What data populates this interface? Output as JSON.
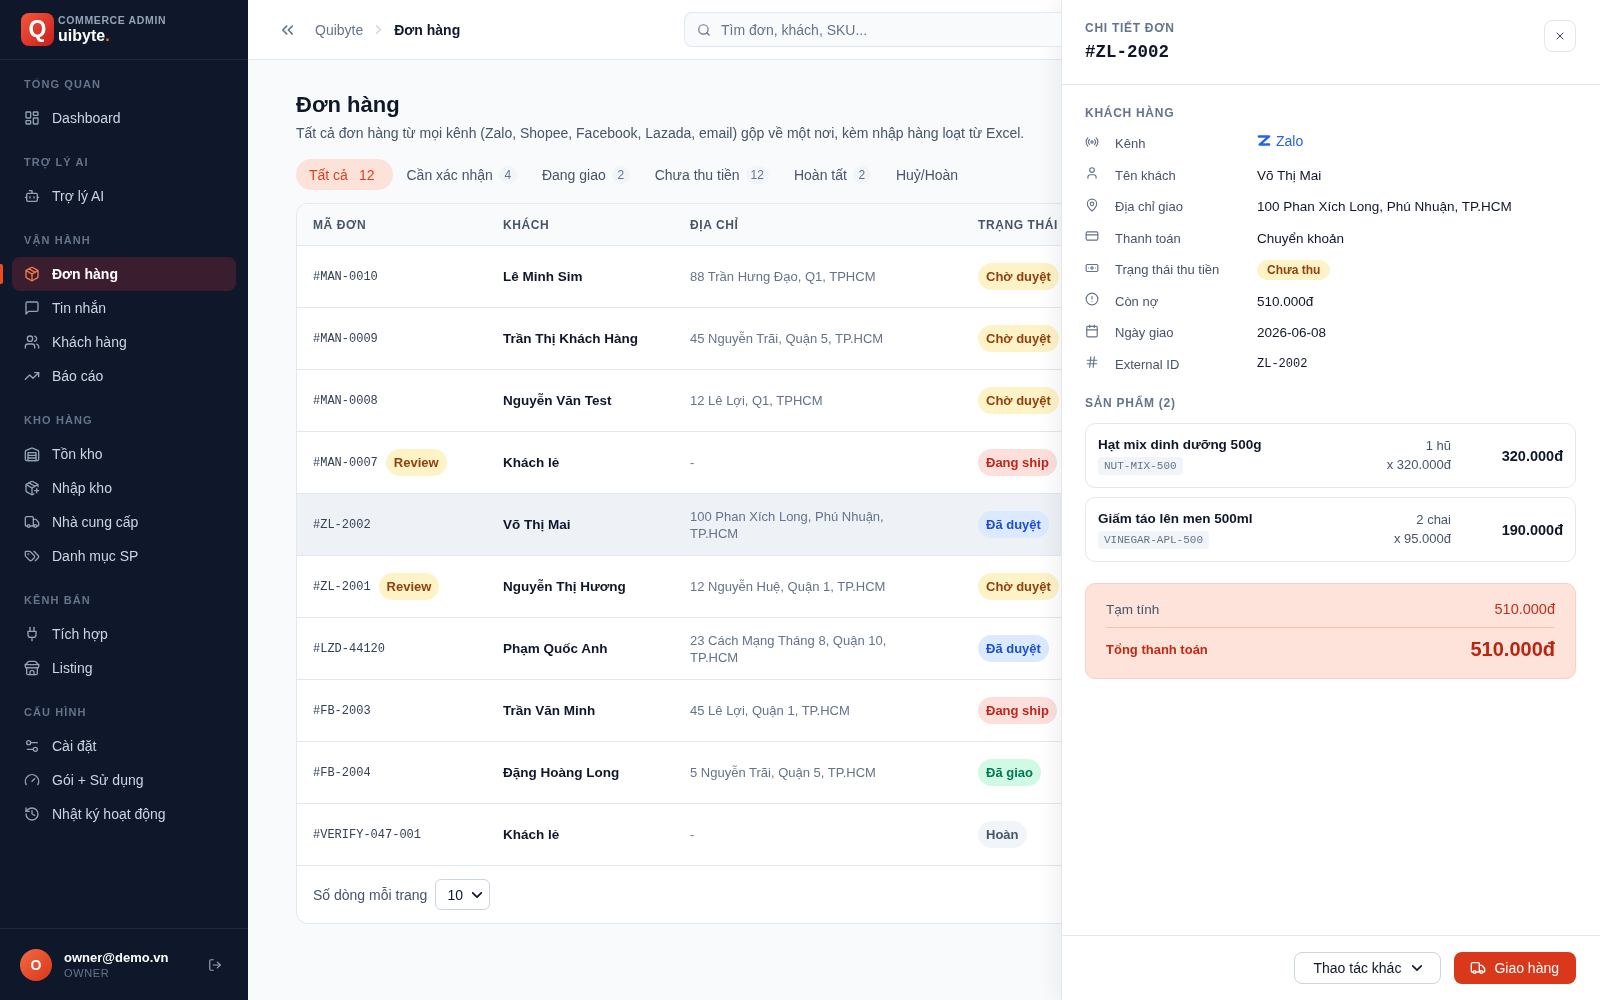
{
  "sidebar": {
    "brand": {
      "mark": "Q",
      "caption": "COMMERCE ADMIN",
      "name": "uibyte",
      "dot": "."
    },
    "sections": [
      {
        "title": "TỔNG QUAN",
        "items": [
          {
            "label": "Dashboard",
            "selected": false
          }
        ]
      },
      {
        "title": "TRỢ LÝ AI",
        "items": [
          {
            "label": "Trợ lý AI",
            "selected": false
          }
        ]
      },
      {
        "title": "VẬN HÀNH",
        "items": [
          {
            "label": "Đơn hàng",
            "selected": true
          },
          {
            "label": "Tin nhắn",
            "selected": false
          },
          {
            "label": "Khách hàng",
            "selected": false
          },
          {
            "label": "Báo cáo",
            "selected": false
          }
        ]
      },
      {
        "title": "KHO HÀNG",
        "items": [
          {
            "label": "Tồn kho",
            "selected": false
          },
          {
            "label": "Nhập kho",
            "selected": false
          },
          {
            "label": "Nhà cung cấp",
            "selected": false
          },
          {
            "label": "Danh mục SP",
            "selected": false
          }
        ]
      },
      {
        "title": "KÊNH BÁN",
        "items": [
          {
            "label": "Tích hợp",
            "selected": false
          },
          {
            "label": "Listing",
            "selected": false
          }
        ]
      },
      {
        "title": "CẤU HÌNH",
        "items": [
          {
            "label": "Cài đặt",
            "selected": false
          },
          {
            "label": "Gói + Sử dụng",
            "selected": false
          },
          {
            "label": "Nhật ký hoạt động",
            "selected": false
          }
        ]
      }
    ],
    "user": {
      "initial": "O",
      "email": "owner@demo.vn",
      "role": "OWNER"
    }
  },
  "topbar": {
    "breadcrumb": [
      {
        "label": "Quibyte"
      },
      {
        "label": "Đơn hàng"
      }
    ],
    "search": {
      "placeholder": "Tìm đơn, khách, SKU..."
    }
  },
  "page": {
    "title": "Đơn hàng",
    "subtitle": "Tất cả đơn hàng từ mọi kênh (Zalo, Shopee, Facebook, Lazada, email) gộp về một nơi, kèm nhập hàng loạt từ Excel.",
    "tabs": [
      {
        "label": "Tất cả",
        "count": "12",
        "selected": true
      },
      {
        "label": "Cần xác nhận",
        "count": "4",
        "selected": false
      },
      {
        "label": "Đang giao",
        "count": "2",
        "selected": false
      },
      {
        "label": "Chưa thu tiền",
        "count": "12",
        "selected": false
      },
      {
        "label": "Hoàn tất",
        "count": "2",
        "selected": false
      },
      {
        "label": "Huỷ/Hoàn",
        "selected": false
      }
    ],
    "table": {
      "columns": [
        "MÃ ĐƠN",
        "KHÁCH",
        "ĐỊA CHỈ",
        "TRẠNG THÁI"
      ],
      "rows": [
        {
          "id": "#MAN-0010",
          "customer": "Lê Minh Sim",
          "address": "88 Trần Hưng Đạo, Q1, TPHCM",
          "status": {
            "label": "Chờ duyệt",
            "kind": "pending"
          },
          "selected": false
        },
        {
          "id": "#MAN-0009",
          "customer": "Trần Thị Khách Hàng",
          "address": "45 Nguyễn Trãi, Quận 5, TP.HCM",
          "status": {
            "label": "Chờ duyệt",
            "kind": "pending"
          },
          "selected": false
        },
        {
          "id": "#MAN-0008",
          "customer": "Nguyễn Văn Test",
          "address": "12 Lê Lợi, Q1, TPHCM",
          "status": {
            "label": "Chờ duyệt",
            "kind": "pending"
          },
          "selected": false
        },
        {
          "id": "#MAN-0007",
          "flag": "Review",
          "customer": "Khách lẻ",
          "address": "-",
          "status": {
            "label": "Đang ship",
            "kind": "shipping"
          },
          "selected": false
        },
        {
          "id": "#ZL-2002",
          "customer": "Võ Thị Mai",
          "address": "100 Phan Xích Long, Phú Nhuận, TP.HCM",
          "status": {
            "label": "Đã duyệt",
            "kind": "approved"
          },
          "selected": true
        },
        {
          "id": "#ZL-2001",
          "flag": "Review",
          "customer": "Nguyễn Thị Hương",
          "address": "12 Nguyễn Huệ, Quận 1, TP.HCM",
          "status": {
            "label": "Chờ duyệt",
            "kind": "pending"
          },
          "selected": false
        },
        {
          "id": "#LZD-44120",
          "customer": "Phạm Quốc Anh",
          "address": "23 Cách Mạng Tháng 8, Quận 10, TP.HCM",
          "status": {
            "label": "Đã duyệt",
            "kind": "approved"
          },
          "selected": false
        },
        {
          "id": "#FB-2003",
          "customer": "Trần Văn Minh",
          "address": "45 Lê Lợi, Quận 1, TP.HCM",
          "status": {
            "label": "Đang ship",
            "kind": "shipping"
          },
          "selected": false
        },
        {
          "id": "#FB-2004",
          "customer": "Đặng Hoàng Long",
          "address": "5 Nguyễn Trãi, Quận 5, TP.HCM",
          "status": {
            "label": "Đã giao",
            "kind": "delivered"
          },
          "selected": false
        },
        {
          "id": "#VERIFY-047-001",
          "customer": "Khách lẻ",
          "address": "-",
          "status": {
            "label": "Hoàn",
            "kind": "returned"
          },
          "selected": false
        }
      ]
    },
    "pagination": {
      "label": "Số dòng mỗi trang",
      "page_size": "10"
    }
  },
  "order_detail": {
    "caption": "CHI TIẾT ĐƠN",
    "order_id": "#ZL-2002",
    "customer_title": "KHÁCH HÀNG",
    "fields": [
      {
        "label": "Kênh",
        "value": "Zalo",
        "kind": "channel"
      },
      {
        "label": "Tên khách",
        "value": "Võ Thị Mai",
        "kind": "text"
      },
      {
        "label": "Địa chỉ giao",
        "value": "100 Phan Xích Long, Phú Nhuận, TP.HCM",
        "kind": "text"
      },
      {
        "label": "Thanh toán",
        "value": "Chuyển khoản",
        "kind": "text"
      },
      {
        "label": "Trạng thái thu tiền",
        "value": "Chưa thu",
        "kind": "badge"
      },
      {
        "label": "Còn nợ",
        "value": "510.000đ",
        "kind": "text"
      },
      {
        "label": "Ngày giao",
        "value": "2026-06-08",
        "kind": "text"
      },
      {
        "label": "External ID",
        "value": "ZL-2002",
        "kind": "code"
      }
    ],
    "products_title": "SẢN PHẨM (2)",
    "products": [
      {
        "name": "Hạt mix dinh dưỡng 500g",
        "sku": "NUT-MIX-500",
        "quantity": "1 hũ",
        "unit_price": "x 320.000đ",
        "total": "320.000đ"
      },
      {
        "name": "Giấm táo lên men 500ml",
        "sku": "VINEGAR-APL-500",
        "quantity": "2 chai",
        "unit_price": "x 95.000đ",
        "total": "190.000đ"
      }
    ],
    "summary": {
      "subtotal_label": "Tạm tính",
      "subtotal": "510.000đ",
      "total_label": "Tổng thanh toán",
      "total": "510.000đ"
    },
    "actions": [
      {
        "label": "Thao tác khác",
        "kind": "menu"
      },
      {
        "label": "Giao hàng",
        "kind": "primary"
      }
    ]
  }
}
